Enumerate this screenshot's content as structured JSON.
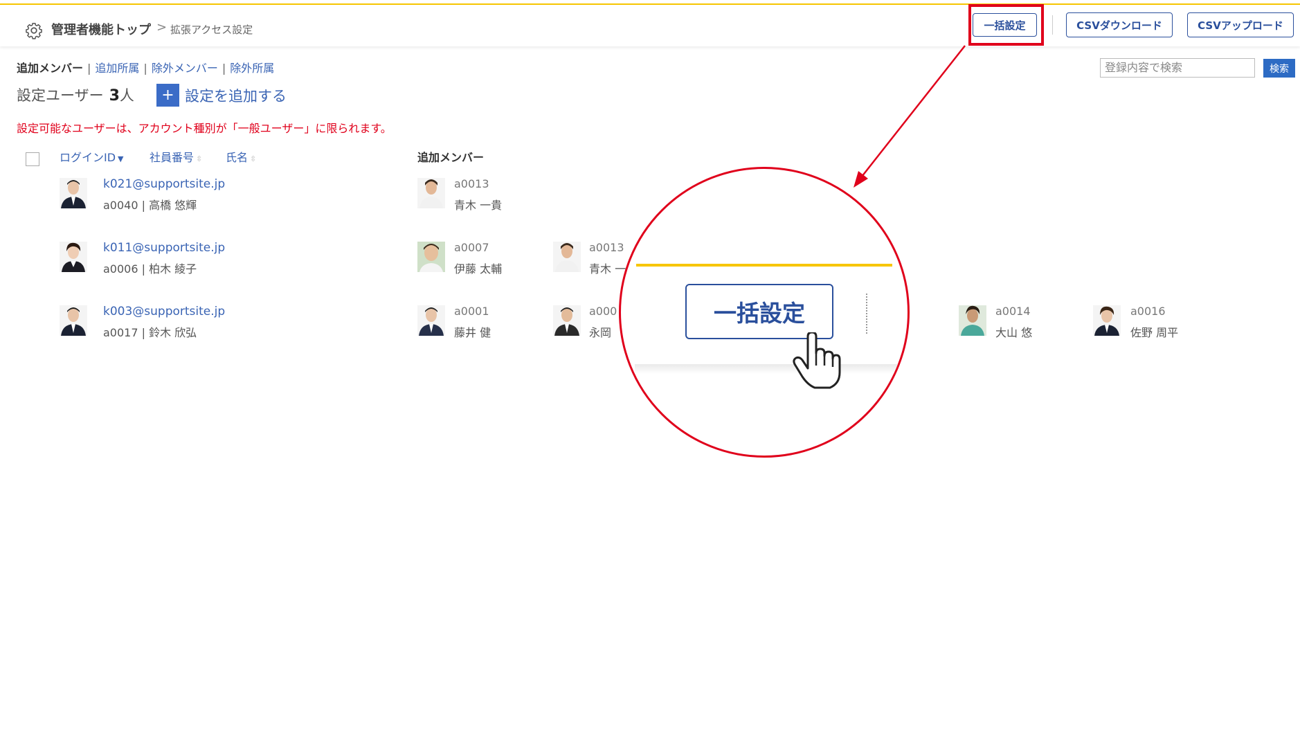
{
  "header": {
    "breadcrumb_home": "管理者機能トップ",
    "breadcrumb_sep": ">",
    "breadcrumb_current": "拡張アクセス設定",
    "bulk_button": "一括設定",
    "csv_download": "CSVダウンロード",
    "csv_upload": "CSVアップロード"
  },
  "tabs": [
    {
      "label": "追加メンバー",
      "active": true
    },
    {
      "label": "追加所属",
      "active": false
    },
    {
      "label": "除外メンバー",
      "active": false
    },
    {
      "label": "除外所属",
      "active": false
    }
  ],
  "tab_sep": "|",
  "search": {
    "placeholder": "登録内容で検索",
    "button": "検索"
  },
  "summary": {
    "label": "設定ユーザー",
    "count": "3",
    "unit": "人",
    "add_icon": "+",
    "add_label": "設定を追加する"
  },
  "notice": "設定可能なユーザーは、アカウント種別が「一般ユーザー」に限られます。",
  "columns": {
    "login_id": "ログインID",
    "employee_no": "社員番号",
    "name": "氏名",
    "members": "追加メンバー"
  },
  "rows": [
    {
      "login_id": "k021@supportsite.jp",
      "sub": "a0040 | 高橋 悠輝",
      "members": [
        {
          "code": "a0013",
          "name": "青木 一貴"
        }
      ]
    },
    {
      "login_id": "k011@supportsite.jp",
      "sub": "a0006 | 柏木 綾子",
      "members": [
        {
          "code": "a0007",
          "name": "伊藤 太輔"
        },
        {
          "code": "a0013",
          "name": "青木 一"
        }
      ]
    },
    {
      "login_id": "k003@supportsite.jp",
      "sub": "a0017 | 鈴木 欣弘",
      "members": [
        {
          "code": "a0001",
          "name": "藤井 健"
        },
        {
          "code": "a000",
          "name": "永岡 "
        },
        {
          "code": "a0014",
          "name": "大山 悠"
        },
        {
          "code": "a0016",
          "name": "佐野 周平"
        }
      ]
    }
  ],
  "zoom": {
    "button_label": "一括設定"
  },
  "colors": {
    "accent": "#2a4f9c",
    "highlight": "#e0001b",
    "topbar": "#f7c600",
    "link": "#3a64b4"
  }
}
